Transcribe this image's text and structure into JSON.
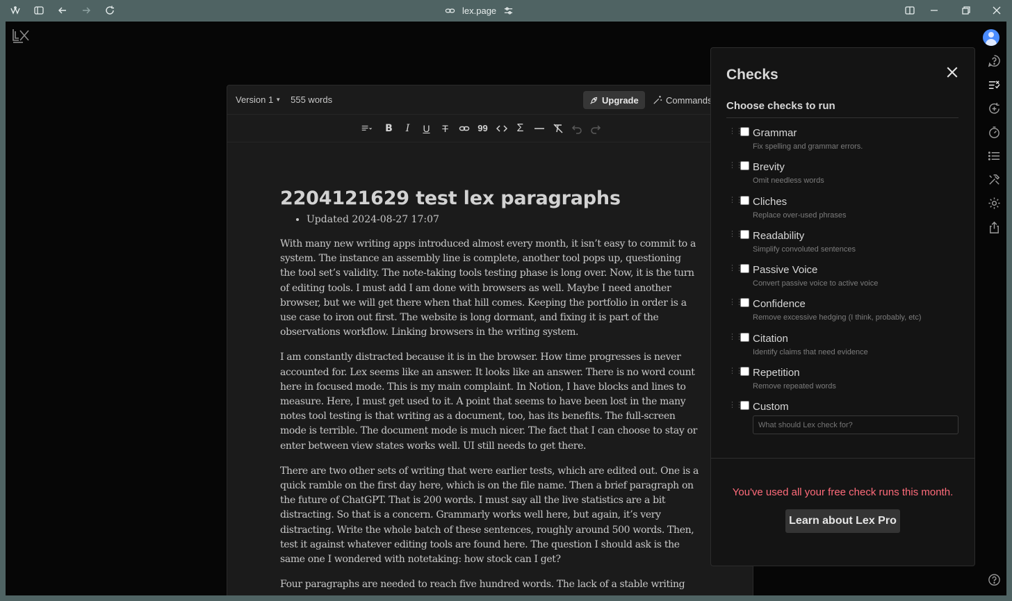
{
  "browser": {
    "url": "lex.page"
  },
  "editor": {
    "version_label": "Version 1",
    "word_count": "555 words",
    "upgrade_label": "Upgrade",
    "commands_label": "Commands",
    "document": {
      "title": "2204121629 test lex paragraphs",
      "meta_bullet": "Updated 2024-08-27 17:07",
      "paragraphs": [
        "With many new writing apps introduced almost every month, it isn’t easy to commit to a system. The instance an assembly line is complete, another tool pops up, questioning the tool set’s validity. The note-taking tools testing phase is long over. Now, it is the turn of editing tools. I must add I am done with browsers as well. Maybe I need another browser, but we will get there when that hill comes. Keeping the portfolio in order is a use case to iron out first. The website is long dormant, and fixing it is part of the observations workflow. Linking browsers in the writing system.",
        "I am constantly distracted because it is in the browser. How time progresses is never accounted for. Lex seems like an answer. It looks like an answer. There is no word count here in focused mode. This is my main complaint. In Notion, I have blocks and lines to measure. Here, I must get used to it. A point that seems to have been lost in the many notes tool testing is that writing as a document, too, has its benefits. The full-screen mode is terrible. The document mode is much nicer. The fact that I can choose to stay or enter between view states works well. UI still needs to get there.",
        "There are two other sets of writing that were earlier tests, which are edited out. One is a quick ramble on the first day here, which is on the file name. Then a brief paragraph on the future of ChatGPT. That is 200 words. I must say all the live statistics are a bit distracting. So that is a concern. Grammarly works well here, but again, it’s very distracting. Write the whole batch of these sentences, roughly around 500 words. Then, test it against whatever editing tools are found here. The question I should ask is the same one I wondered with notetaking: how stock can I get?",
        "Four paragraphs are needed to reach five hundred words. The lack of a stable writing"
      ]
    }
  },
  "checks_panel": {
    "title": "Checks",
    "subtitle": "Choose checks to run",
    "items": [
      {
        "name": "Grammar",
        "desc": "Fix spelling and grammar errors."
      },
      {
        "name": "Brevity",
        "desc": "Omit needless words"
      },
      {
        "name": "Cliches",
        "desc": "Replace over-used phrases"
      },
      {
        "name": "Readability",
        "desc": "Simplify convoluted sentences"
      },
      {
        "name": "Passive Voice",
        "desc": "Convert passive voice to active voice"
      },
      {
        "name": "Confidence",
        "desc": "Remove excessive hedging (I think, probably, etc)"
      },
      {
        "name": "Citation",
        "desc": "Identify claims that need evidence"
      },
      {
        "name": "Repetition",
        "desc": "Remove repeated words"
      },
      {
        "name": "Custom",
        "desc": ""
      }
    ],
    "custom_placeholder": "What should Lex check for?",
    "limit_message": "You've used all your free check runs this month.",
    "pro_button": "Learn about Lex Pro"
  },
  "colors": {
    "chrome": "#4f6363",
    "app_bg": "#060606",
    "editor_bg": "#1b1b1b",
    "panel_bg": "#141414",
    "warning": "#ff6b7a"
  }
}
